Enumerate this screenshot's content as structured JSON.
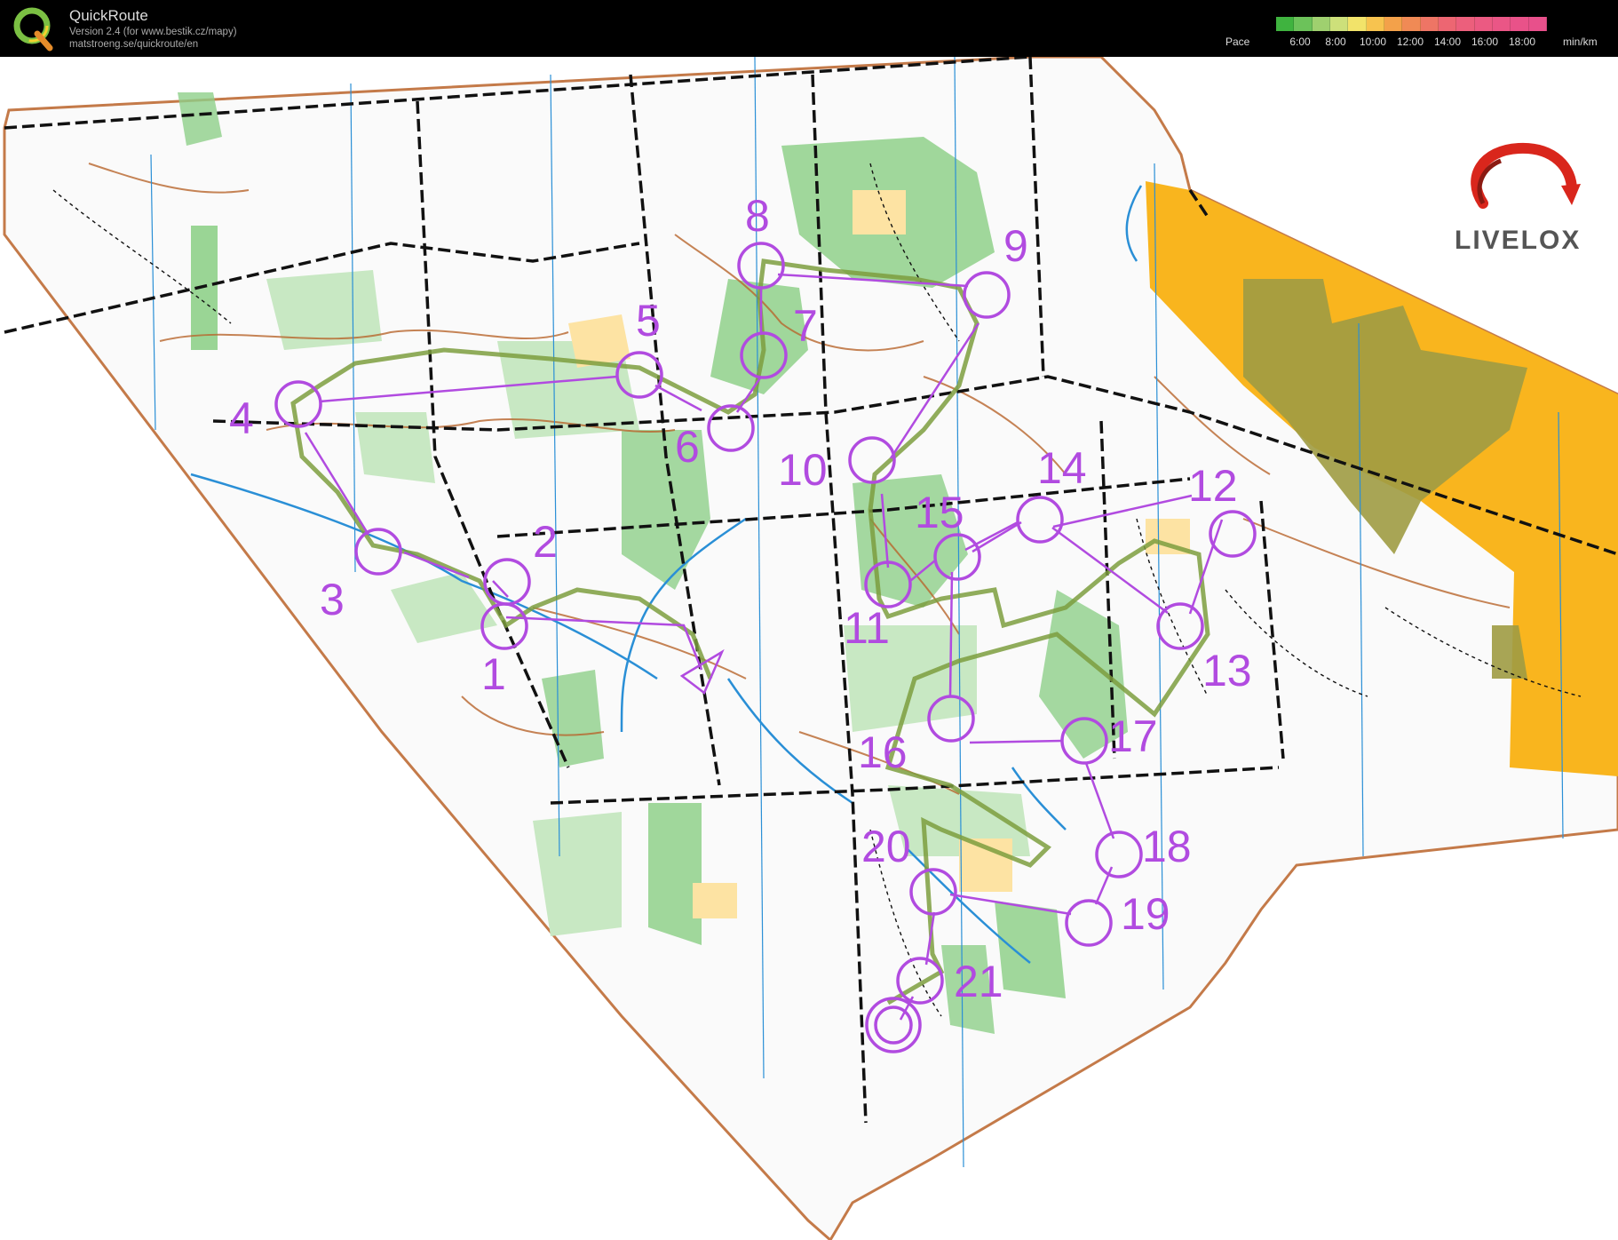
{
  "app": {
    "title": "QuickRoute",
    "version": "Version 2.4  (for www.bestik.cz/mapy)",
    "url": "matstroeng.se/quickroute/en"
  },
  "pace_legend": {
    "label": "Pace",
    "ticks": [
      "6:00",
      "8:00",
      "10:00",
      "12:00",
      "14:00",
      "16:00",
      "18:00"
    ],
    "unit": "min/km",
    "gradient_colors": [
      "#3fb33f",
      "#6cc25a",
      "#9fd06f",
      "#cde07a",
      "#f2e36a",
      "#f7c34f",
      "#f3a14a",
      "#f08a55",
      "#ee7565",
      "#ed6672",
      "#ec5f7c",
      "#eb5a82",
      "#ea5686",
      "#e95289",
      "#e8508b"
    ]
  },
  "brand": {
    "logo_text": "LIVELOX",
    "accent_red": "#d9261c"
  },
  "course": {
    "color": "#b14be0",
    "controls": [
      "1",
      "2",
      "3",
      "4",
      "5",
      "6",
      "7",
      "8",
      "9",
      "10",
      "11",
      "12",
      "13",
      "14",
      "15",
      "16",
      "17",
      "18",
      "19",
      "20",
      "21"
    ]
  },
  "map_colors": {
    "forest_green": "#8fd08a",
    "light_green": "#c8e8c3",
    "open_yellow": "#f9b51e",
    "rough_yellow": "#fde3a3",
    "brown": "#b8652c",
    "olive": "#9e9b43",
    "water_blue": "#2a8fd6",
    "route_green": "#7d9e3e"
  }
}
